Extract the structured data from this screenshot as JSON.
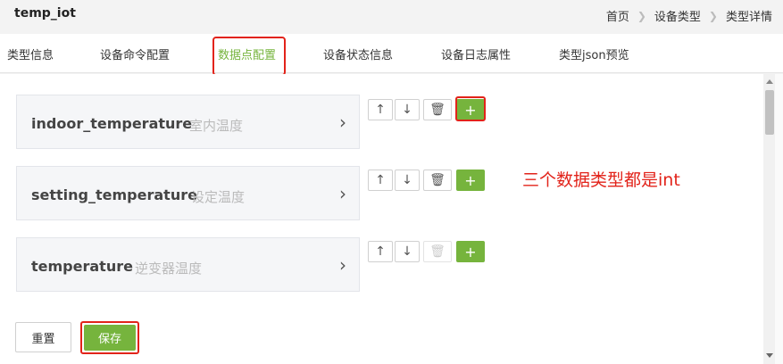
{
  "header": {
    "title": "temp_iot"
  },
  "breadcrumb": [
    "首页",
    "设备类型",
    "类型详情"
  ],
  "tabs": [
    {
      "label": "类型信息",
      "active": false
    },
    {
      "label": "设备命令配置",
      "active": false
    },
    {
      "label": "数据点配置",
      "active": true
    },
    {
      "label": "设备状态信息",
      "active": false
    },
    {
      "label": "设备日志属性",
      "active": false
    },
    {
      "label": "类型json预览",
      "active": false
    }
  ],
  "datapoints": [
    {
      "name": "indoor_temperature",
      "desc": "室内温度"
    },
    {
      "name": "setting_temperature",
      "desc": "设定温度"
    },
    {
      "name": "temperature",
      "desc": "逆变器温度"
    }
  ],
  "icons": {
    "up": "arrow-up-icon",
    "down": "arrow-down-icon",
    "delete": "trash-icon",
    "add": "plus-icon",
    "expand": "chevron-right-icon"
  },
  "annotation": "三个数据类型都是int",
  "buttons": {
    "reset": "重置",
    "save": "保存"
  },
  "colors": {
    "accent": "#76b43d",
    "highlight": "#e2231a"
  }
}
